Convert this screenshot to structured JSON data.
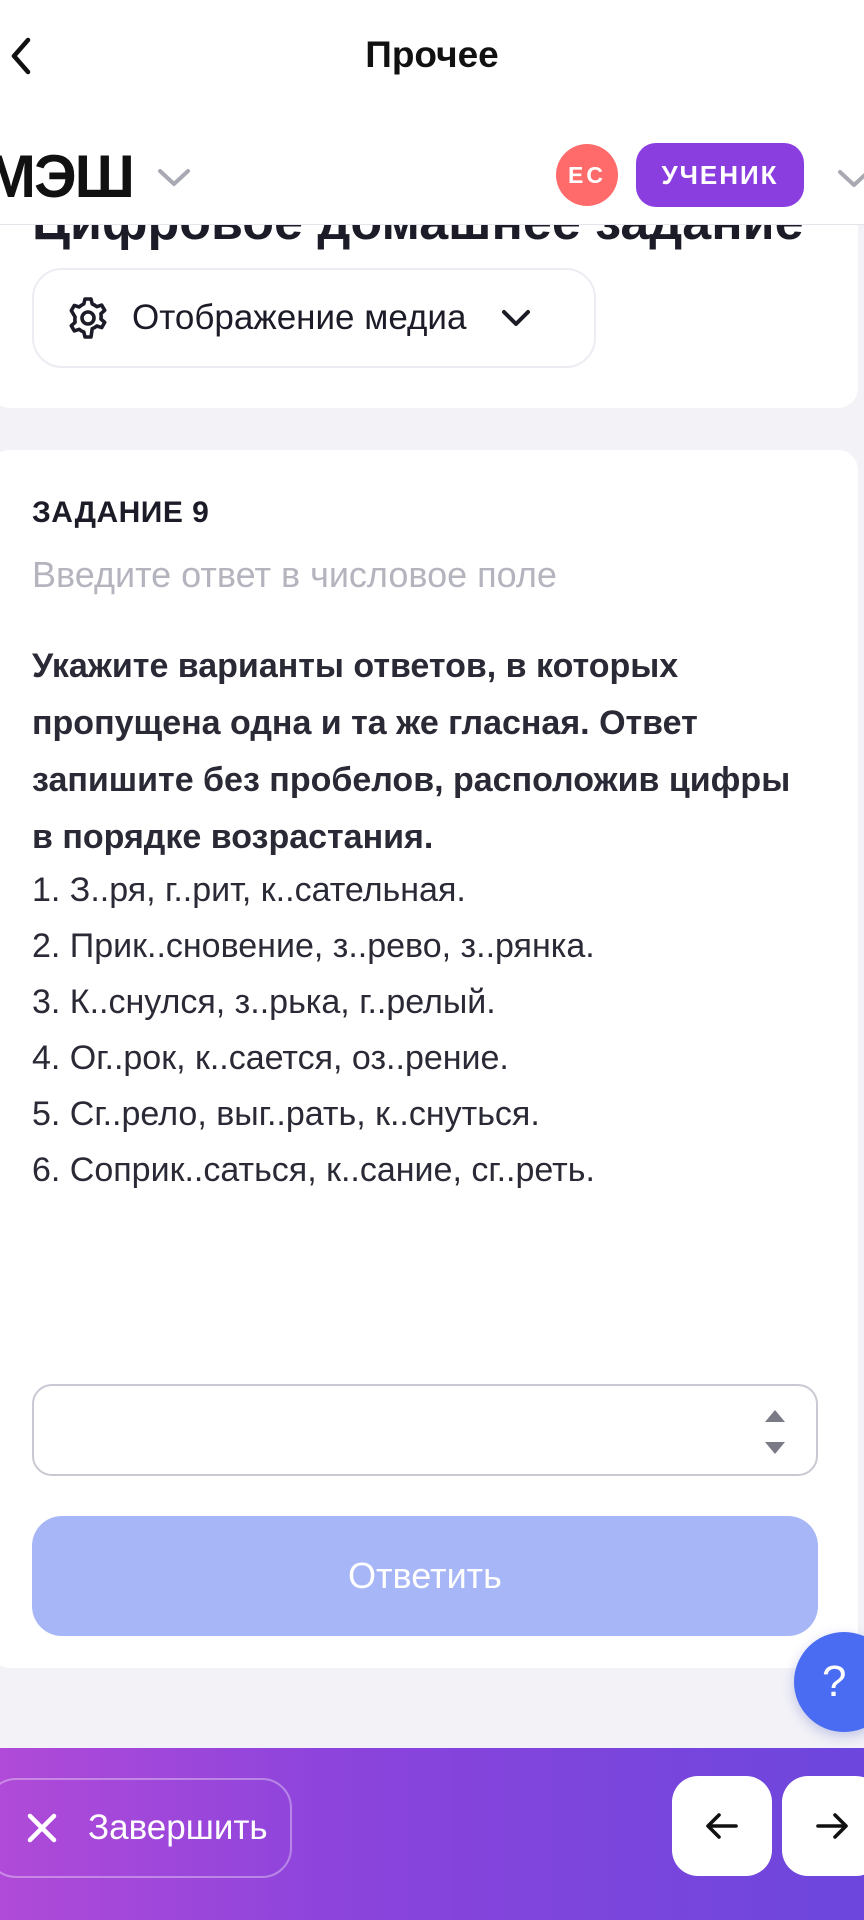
{
  "topbar": {
    "title": "Прочее"
  },
  "header": {
    "logo": "МЭШ",
    "avatar_initials": "ЕС",
    "role": "УЧЕНИК"
  },
  "top_card": {
    "title": "Цифровое домашнее задание",
    "media_button_label": "Отображение медиа"
  },
  "task": {
    "number_label": "ЗАДАНИЕ 9",
    "hint": "Введите ответ в числовое поле",
    "question": "Укажите варианты ответов, в которых пропущена одна и та же гласная. Ответ запишите без пробелов, расположив цифры в порядке возрастания.",
    "options": [
      "1. З..ря, г..рит, к..сательная.",
      "2. Прик..сновение, з..рево, з..рянка.",
      "3. К..снулся, з..рька, г..релый.",
      "4. Ог..рок, к..сается, оз..рение.",
      "5. Сг..рело, выг..рать, к..снуться.",
      "6. Соприк..саться, к..сание, сг..реть."
    ],
    "answer_value": "",
    "submit_label": "Ответить"
  },
  "help": {
    "label": "?"
  },
  "bottom_bar": {
    "finish_label": "Завершить"
  },
  "colors": {
    "accent": "#8b3ee0",
    "avatar": "#ff6b6b",
    "submit_disabled": "#a7b6f7",
    "help": "#4a6cf2",
    "bottom_gradient_start": "#b04ad8",
    "bottom_gradient_end": "#6c46dd"
  }
}
